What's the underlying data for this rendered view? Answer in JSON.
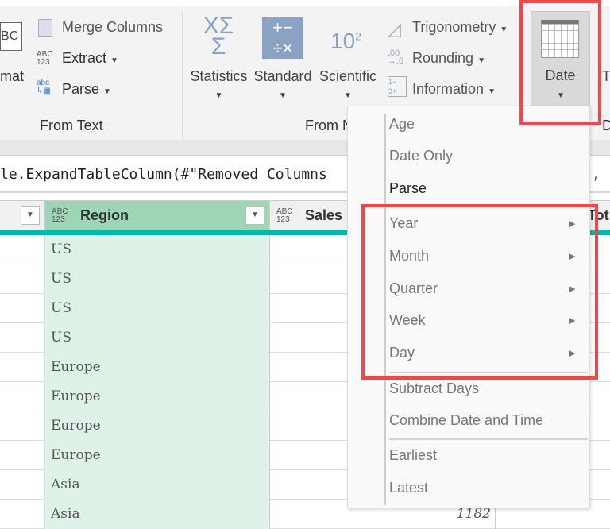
{
  "ribbon": {
    "format_label": "mat",
    "merge_columns": "Merge Columns",
    "extract": "Extract",
    "parse": "Parse",
    "from_text": "From Text",
    "statistics": "Statistics",
    "standard": "Standard",
    "scientific": "Scientific",
    "trigonometry": "Trigonometry",
    "rounding": "Rounding",
    "information": "Information",
    "from_number": "From N",
    "date": "Date",
    "next_partial": "T",
    "from_date_partial": "D"
  },
  "formula": "le.ExpandTableColumn(#\"Removed Columns",
  "formula_tail": ",",
  "columns": [
    {
      "type": "ABC\n123",
      "name": "Region"
    },
    {
      "type": "ABC\n123",
      "name": "Sales"
    },
    {
      "name": "Tot"
    }
  ],
  "rows": [
    "US",
    "US",
    "US",
    "US",
    "Europe",
    "Europe",
    "Europe",
    "Europe",
    "Asia",
    "Asia"
  ],
  "sales_visible": "1182",
  "menu": {
    "items": [
      "Age",
      "Date Only",
      "Parse",
      "Year",
      "Month",
      "Quarter",
      "Week",
      "Day",
      "Subtract Days",
      "Combine Date and Time",
      "Earliest",
      "Latest"
    ]
  }
}
